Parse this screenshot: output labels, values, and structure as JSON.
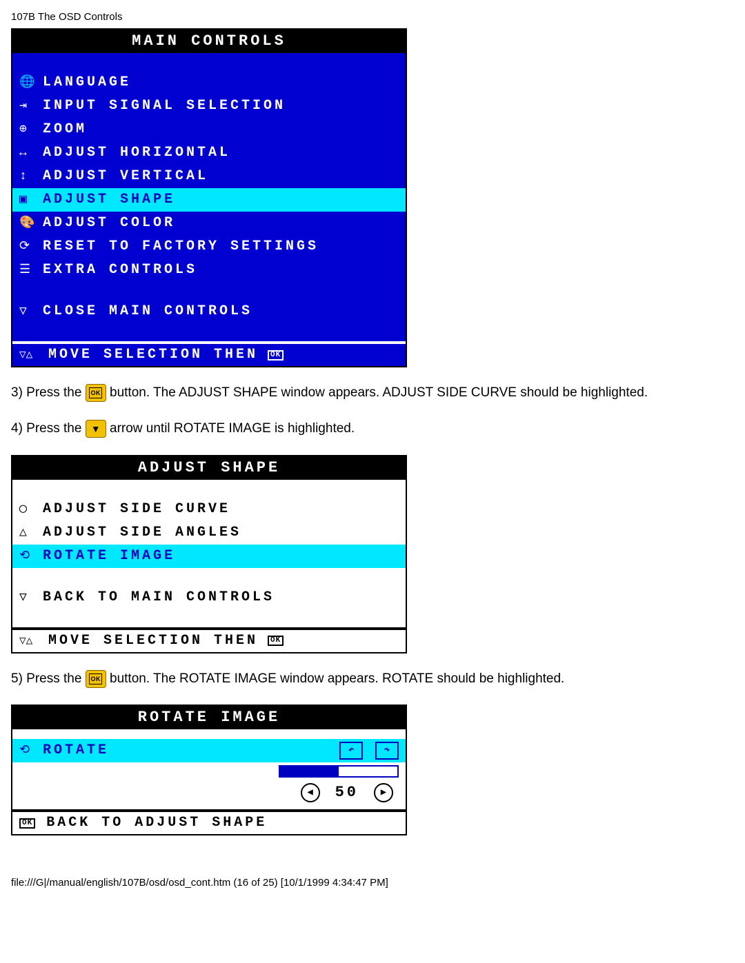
{
  "page_header": "107B The OSD Controls",
  "main_controls": {
    "title": "MAIN CONTROLS",
    "items": [
      {
        "icon": "🌐",
        "label": "LANGUAGE",
        "hl": false
      },
      {
        "icon": "⇥",
        "label": "INPUT SIGNAL SELECTION",
        "hl": false
      },
      {
        "icon": "⊕",
        "label": "ZOOM",
        "hl": false
      },
      {
        "icon": "↔",
        "label": "ADJUST HORIZONTAL",
        "hl": false
      },
      {
        "icon": "↕",
        "label": "ADJUST VERTICAL",
        "hl": false
      },
      {
        "icon": "▣",
        "label": "ADJUST SHAPE",
        "hl": true
      },
      {
        "icon": "🎨",
        "label": "ADJUST COLOR",
        "hl": false
      },
      {
        "icon": "⟳",
        "label": "RESET TO FACTORY SETTINGS",
        "hl": false
      },
      {
        "icon": "☰",
        "label": "EXTRA CONTROLS",
        "hl": false
      }
    ],
    "close": {
      "icon": "▽",
      "label": "CLOSE MAIN CONTROLS"
    },
    "footer": "MOVE SELECTION THEN"
  },
  "instr3_a": "3) Press the ",
  "instr3_b": " button. The ADJUST SHAPE window appears. ADJUST SIDE CURVE should be highlighted.",
  "instr4_a": "4) Press the ",
  "instr4_b": " arrow until ROTATE IMAGE is highlighted.",
  "adjust_shape": {
    "title": "ADJUST SHAPE",
    "items": [
      {
        "icon": "◯",
        "label": "ADJUST SIDE CURVE",
        "hl": false
      },
      {
        "icon": "△",
        "label": "ADJUST SIDE ANGLES",
        "hl": false
      },
      {
        "icon": "⟲",
        "label": "ROTATE IMAGE",
        "hl": true
      }
    ],
    "back": {
      "icon": "▽",
      "label": "BACK TO MAIN CONTROLS"
    },
    "footer": "MOVE SELECTION THEN"
  },
  "instr5_a": "5) Press the ",
  "instr5_b": " button. The ROTATE IMAGE window appears. ROTATE should be highlighted.",
  "rotate_image": {
    "title": "ROTATE IMAGE",
    "item": {
      "icon": "⟲",
      "label": "ROTATE"
    },
    "value": "50",
    "progress_pct": 50,
    "back": "BACK TO ADJUST SHAPE"
  },
  "page_footer": "file:///G|/manual/english/107B/osd/osd_cont.htm (16 of 25) [10/1/1999 4:34:47 PM]"
}
